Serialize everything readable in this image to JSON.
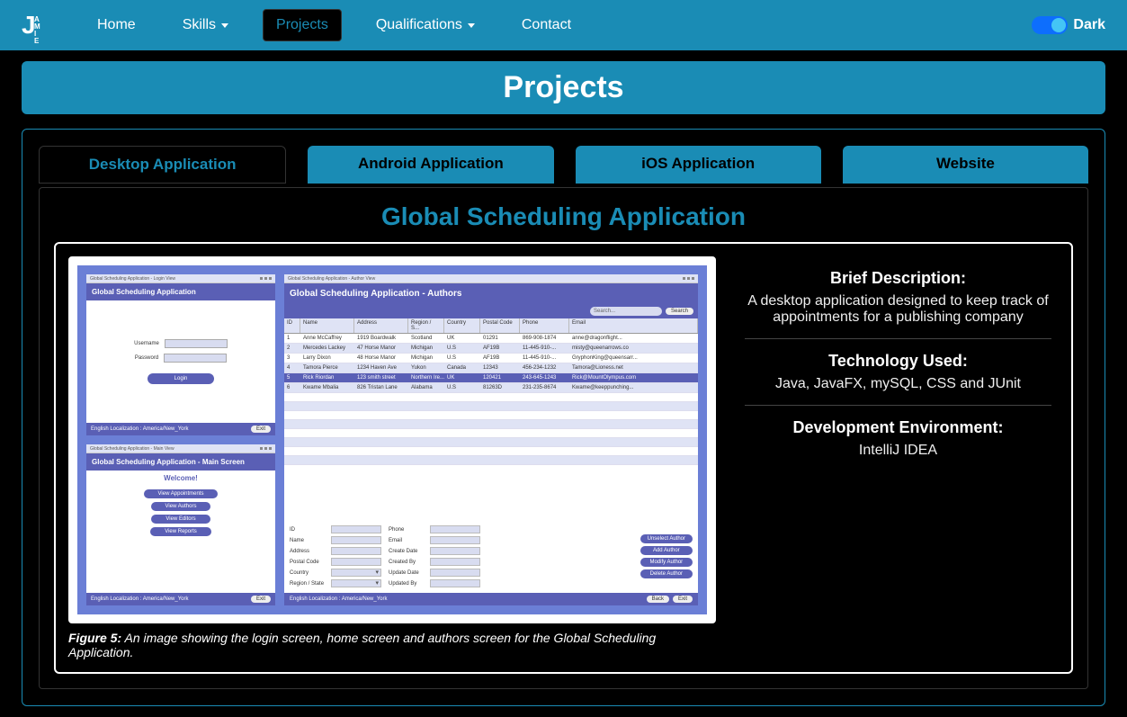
{
  "nav": {
    "logo_main": "J",
    "logo_sub": "AMIE",
    "home": "Home",
    "skills": "Skills",
    "projects": "Projects",
    "qualifications": "Qualifications",
    "contact": "Contact",
    "dark_label": "Dark"
  },
  "page_header": "Projects",
  "tabs": {
    "desktop": "Desktop Application",
    "android": "Android Application",
    "ios": "iOS Application",
    "website": "Website"
  },
  "project": {
    "title": "Global Scheduling Application",
    "caption_label": "Figure 5:",
    "caption_text": " An image showing the login screen, home screen and authors screen for the Global Scheduling Application.",
    "info": {
      "desc_h": "Brief Description:",
      "desc_p": "A desktop application designed to keep track of appointments for a publishing company",
      "tech_h": "Technology Used:",
      "tech_p": "Java, JavaFX, mySQL, CSS and JUnit",
      "env_h": "Development Environment:",
      "env_p": "IntelliJ IDEA"
    }
  },
  "mock": {
    "login_header": "Global Scheduling Application",
    "username_label": "Username",
    "password_label": "Password",
    "login_btn": "Login",
    "locale": "English Localization : America/New_York",
    "exit": "Exit",
    "main_header": "Global Scheduling Application - Main Screen",
    "welcome": "Welcome!",
    "menu1": "View Appointments",
    "menu2": "View Authors",
    "menu3": "View Editors",
    "menu4": "View Reports",
    "author_header": "Global Scheduling Application - Authors",
    "search_ph": "Search...",
    "search_btn": "Search",
    "hdr": {
      "id": "ID",
      "name": "Name",
      "addr": "Address",
      "reg": "Region / S...",
      "ctry": "Country",
      "zip": "Postal Code",
      "ph": "Phone",
      "em": "Email"
    },
    "rows": [
      {
        "id": "1",
        "name": "Anne McCaffrey",
        "addr": "1919 Boardwalk",
        "reg": "Scotland",
        "ctry": "UK",
        "zip": "01291",
        "ph": "869-908-1874",
        "em": "anne@dragonflight..."
      },
      {
        "id": "2",
        "name": "Mercedes Lackey",
        "addr": "47 Horse Manor",
        "reg": "Michigan",
        "ctry": "U.S",
        "zip": "AF19B",
        "ph": "11-445-910-...",
        "em": "misty@queenarrows.co"
      },
      {
        "id": "3",
        "name": "Larry Dixon",
        "addr": "48 Horse Manor",
        "reg": "Michigan",
        "ctry": "U.S",
        "zip": "AF19B",
        "ph": "11-445-910-...",
        "em": "GryphonKing@queensarr..."
      },
      {
        "id": "4",
        "name": "Tamora Pierce",
        "addr": "1234 Haven Ave",
        "reg": "Yukon",
        "ctry": "Canada",
        "zip": "12343",
        "ph": "456-234-1232",
        "em": "Tamora@Lioness.net"
      },
      {
        "id": "5",
        "name": "Rick Riordan",
        "addr": "123 smith street",
        "reg": "Northern Ire...",
        "ctry": "UK",
        "zip": "120421",
        "ph": "243-645-1243",
        "em": "Rick@MountOlympus.com"
      },
      {
        "id": "6",
        "name": "Kwame Mbalia",
        "addr": "826 Tristan Lane",
        "reg": "Alabama",
        "ctry": "U.S",
        "zip": "81263D",
        "ph": "231-235-8674",
        "em": "Kwame@keeppunching..."
      }
    ],
    "form": {
      "id": "ID",
      "name": "Name",
      "addr": "Address",
      "zip": "Postal Code",
      "ctry": "Country",
      "reg": "Region / State",
      "phone": "Phone",
      "email": "Email",
      "cdate": "Create Date",
      "cby": "Created By",
      "udate": "Update Date",
      "uby": "Updated By"
    },
    "actions": {
      "unselect": "Unselect Author",
      "add": "Add Author",
      "modify": "Modify Author",
      "delete": "Delete Author"
    },
    "back": "Back"
  }
}
